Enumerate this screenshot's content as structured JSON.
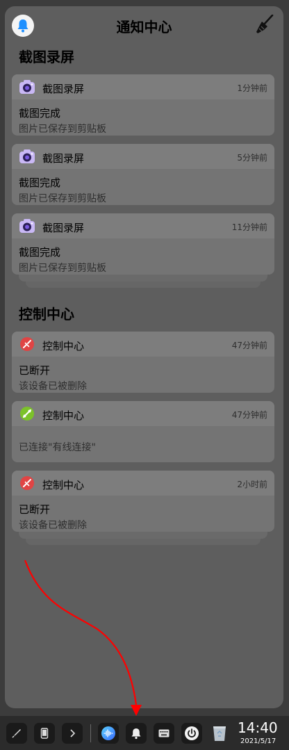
{
  "header": {
    "title": "通知中心"
  },
  "sections": [
    {
      "title": "截图录屏",
      "cards": [
        {
          "app": "截图录屏",
          "time": "1分钟前",
          "title": "截图完成",
          "body": "图片已保存到剪贴板",
          "icon": "camera-icon"
        },
        {
          "app": "截图录屏",
          "time": "5分钟前",
          "title": "截图完成",
          "body": "图片已保存到剪贴板",
          "icon": "camera-icon"
        },
        {
          "app": "截图录屏",
          "time": "11分钟前",
          "title": "截图完成",
          "body": "图片已保存到剪贴板",
          "icon": "camera-icon"
        }
      ]
    },
    {
      "title": "控制中心",
      "cards": [
        {
          "app": "控制中心",
          "time": "47分钟前",
          "title": "已断开",
          "body": "该设备已被删除",
          "icon": "network-disconnected-icon"
        },
        {
          "app": "控制中心",
          "time": "47分钟前",
          "title": "",
          "body": "已连接\"有线连接\"",
          "icon": "network-connected-icon"
        },
        {
          "app": "控制中心",
          "time": "2小时前",
          "title": "已断开",
          "body": "该设备已被删除",
          "icon": "network-disconnected-icon"
        }
      ]
    }
  ],
  "taskbar": {
    "clock_time": "14:40",
    "clock_date": "2021/5/17"
  },
  "colors": {
    "panel": "#5e5e5e",
    "card": "#747474",
    "accent_blue": "#1e90ff",
    "disconnect_red": "#e04444",
    "connect_green": "#7cc22a",
    "arrow_red": "#ff0000"
  }
}
